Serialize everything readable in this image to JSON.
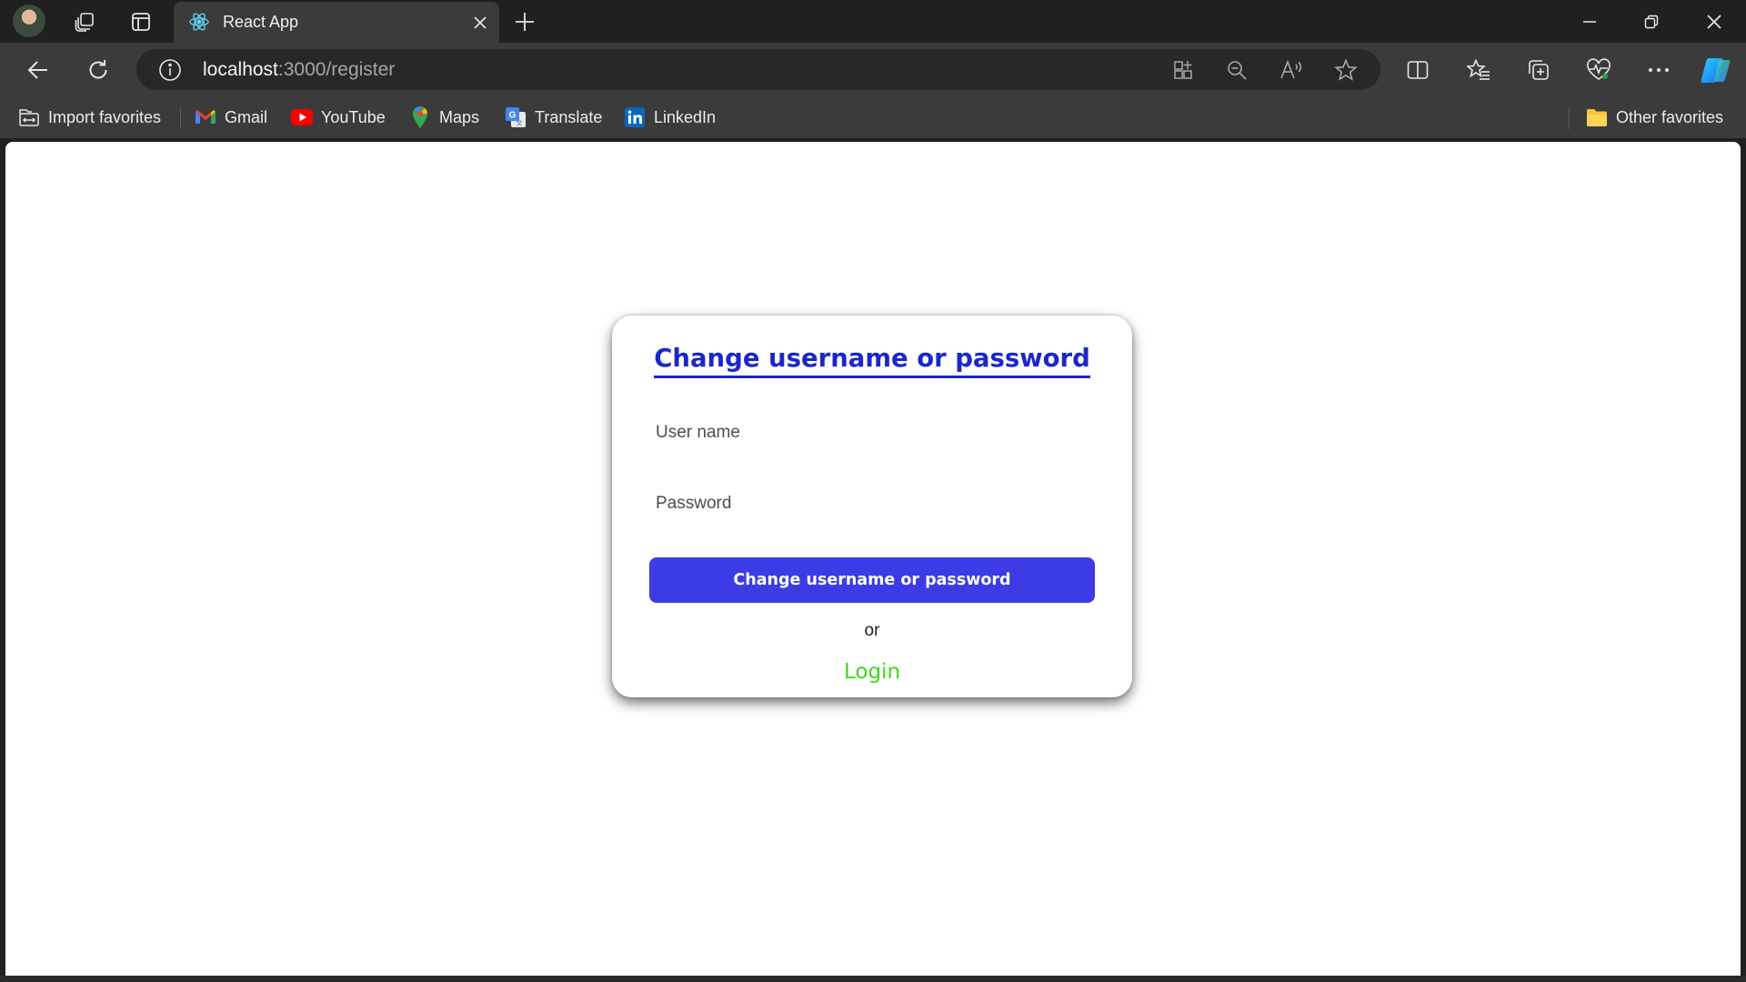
{
  "browser": {
    "tab": {
      "title": "React App"
    },
    "address": {
      "host": "localhost",
      "rest": ":3000/register"
    },
    "icons": {
      "profile": "avatar",
      "workspaces": "workspaces-icon",
      "tab_actions": "tab-actions-icon",
      "new_tab": "plus-icon",
      "back": "back-arrow-icon",
      "refresh": "refresh-icon",
      "site_info": "info-icon",
      "apps": "app-available-icon",
      "zoom": "zoom-out-icon",
      "read_aloud": "read-aloud-icon",
      "favorite": "star-icon",
      "split_screen": "split-screen-icon",
      "favorites": "favorites-icon",
      "collections": "collections-icon",
      "performance": "heart-pulse-icon",
      "more": "more-icon",
      "copilot": "copilot-icon"
    },
    "favorites_bar": {
      "items": [
        {
          "label": "Import favorites",
          "icon": "import-icon"
        },
        {
          "label": "Gmail",
          "icon": "gmail-icon"
        },
        {
          "label": "YouTube",
          "icon": "youtube-icon"
        },
        {
          "label": "Maps",
          "icon": "maps-icon"
        },
        {
          "label": "Translate",
          "icon": "translate-icon"
        },
        {
          "label": "LinkedIn",
          "icon": "linkedin-icon"
        }
      ],
      "other": {
        "label": "Other favorites",
        "icon": "folder-icon"
      }
    }
  },
  "form": {
    "title": "Change username or password",
    "username": {
      "placeholder": "User name",
      "value": ""
    },
    "password": {
      "placeholder": "Password",
      "value": ""
    },
    "submit_label": "Change username or password",
    "or_text": "or",
    "login_label": "Login"
  },
  "colors": {
    "title": "#1b27c9",
    "button": "#3c3ce6",
    "login_link": "#3ed81a",
    "browser_chrome": "#3b3b3b"
  }
}
